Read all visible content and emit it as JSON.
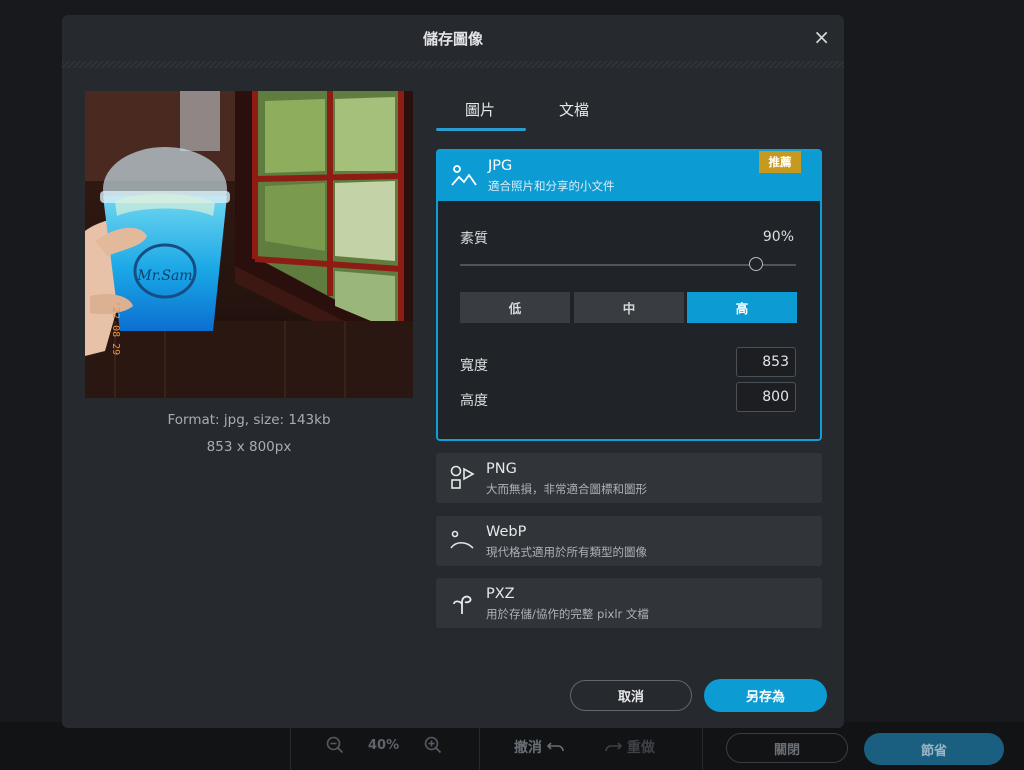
{
  "app_bar": {
    "zoom_level": "40%",
    "zoom_out_icon": "zoom-out-icon",
    "zoom_in_icon": "zoom-in-icon",
    "undo_label": "撤消",
    "redo_label": "重做",
    "close_label": "關閉",
    "save_label": "節省"
  },
  "dialog": {
    "title": "儲存圖像",
    "close_icon": "×",
    "preview": {
      "format_info": "Format: jpg, size: 143kb",
      "dimensions_info": "853 x 800px"
    },
    "tabs": [
      {
        "label": "圖片",
        "active": true
      },
      {
        "label": "文檔",
        "active": false
      }
    ],
    "formats": {
      "jpg": {
        "title": "JPG",
        "description": "適合照片和分享的小文件",
        "badge": "推薦",
        "quality_label": "素質",
        "quality_value": "90%",
        "quality_fraction": 0.9,
        "presets": [
          "低",
          "中",
          "高"
        ],
        "active_preset": "高",
        "width_label": "寬度",
        "width_value": "853",
        "height_label": "高度",
        "height_value": "800"
      },
      "png": {
        "title": "PNG",
        "description": "大而無損，非常適合圖標和圖形"
      },
      "webp": {
        "title": "WebP",
        "description": "現代格式適用於所有類型的圖像"
      },
      "pxz": {
        "title": "PXZ",
        "description": "用於存儲/協作的完整 pixlr 文檔"
      }
    },
    "cancel_label": "取消",
    "save_as_label": "另存為"
  },
  "colors": {
    "accent": "#0c9bd3",
    "badge": "#c69a1e",
    "dialog_bg": "#26292d"
  }
}
